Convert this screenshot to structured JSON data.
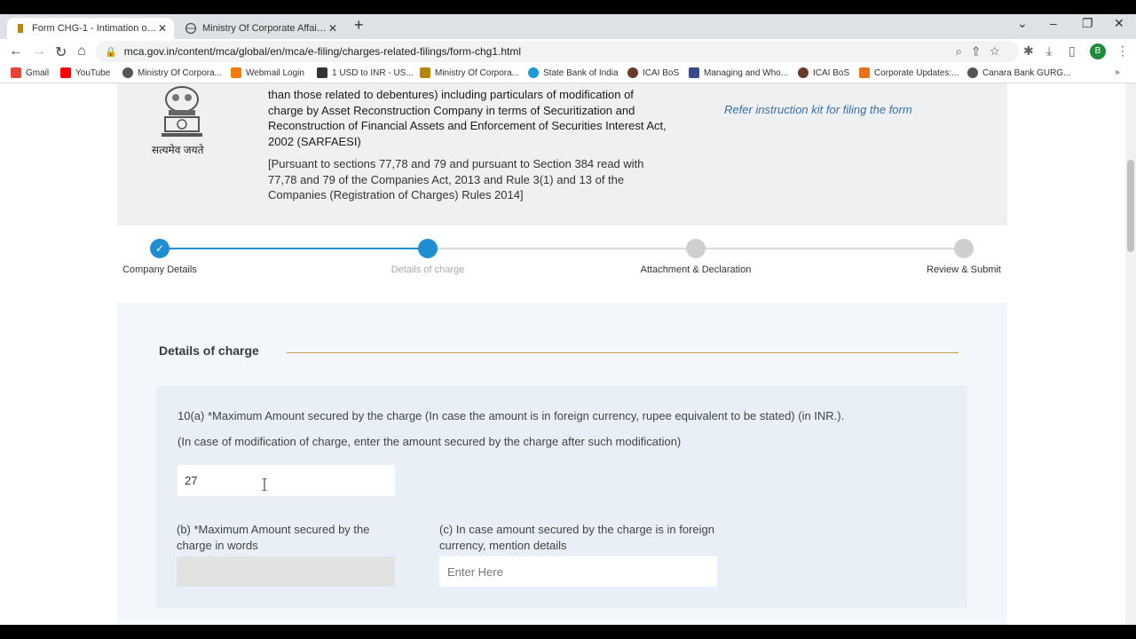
{
  "browser": {
    "tabs": [
      {
        "title": "Form CHG-1 - Intimation of creat",
        "active": true
      },
      {
        "title": "Ministry Of Corporate Affairs - M",
        "active": false
      }
    ],
    "url": "mca.gov.in/content/mca/global/en/mca/e-filing/charges-related-filings/form-chg1.html",
    "profile_initial": "B",
    "bookmarks": [
      "Gmail",
      "YouTube",
      "Ministry Of Corpora...",
      "Webmail Login",
      "1 USD to INR - US...",
      "Ministry Of Corpora...",
      "State Bank of India",
      "ICAI BoS",
      "Managing and Who...",
      "ICAI BoS",
      "Corporate Updates:...",
      "Canara Bank GURG..."
    ]
  },
  "header": {
    "motto": "सत्यमेव जयते",
    "title": "than those related to debentures) including particulars of modification of charge by Asset Reconstruction Company in terms of Securitization and Reconstruction of Financial Assets and Enforcement of Securities Interest Act, 2002 (SARFAESI)",
    "subtitle": "[Pursuant to sections 77,78 and 79 and pursuant to Section 384 read with 77,78 and 79 of the Companies Act, 2013 and Rule 3(1) and 13 of the Companies (Registration of Charges) Rules 2014]",
    "instruction_link": "Refer instruction kit for filing the form"
  },
  "stepper": {
    "steps": [
      {
        "label": "Company Details",
        "state": "done"
      },
      {
        "label": "Details of charge",
        "state": "current"
      },
      {
        "label": "Attachment & Declaration",
        "state": "pending"
      },
      {
        "label": "Review & Submit",
        "state": "pending"
      }
    ]
  },
  "form": {
    "section_title": "Details of charge",
    "q10a_label": "10(a) *Maximum Amount secured by the charge (In case the amount is in foreign currency, rupee equivalent to be stated) (in INR.).",
    "q10a_note": "(In case of modification of charge, enter the amount secured by the charge after such modification)",
    "q10a_value": "27",
    "qb_label": "(b) *Maximum Amount secured by the charge in words",
    "qb_value": "",
    "qc_label": "(c) In case amount secured by the charge is in foreign currency, mention details",
    "qc_placeholder": "Enter Here"
  },
  "colors": {
    "step_done": "#1f8fd1",
    "step_pending": "#cfcfcf",
    "link": "#3a6fa8",
    "section_rule": "#c8a24a"
  }
}
